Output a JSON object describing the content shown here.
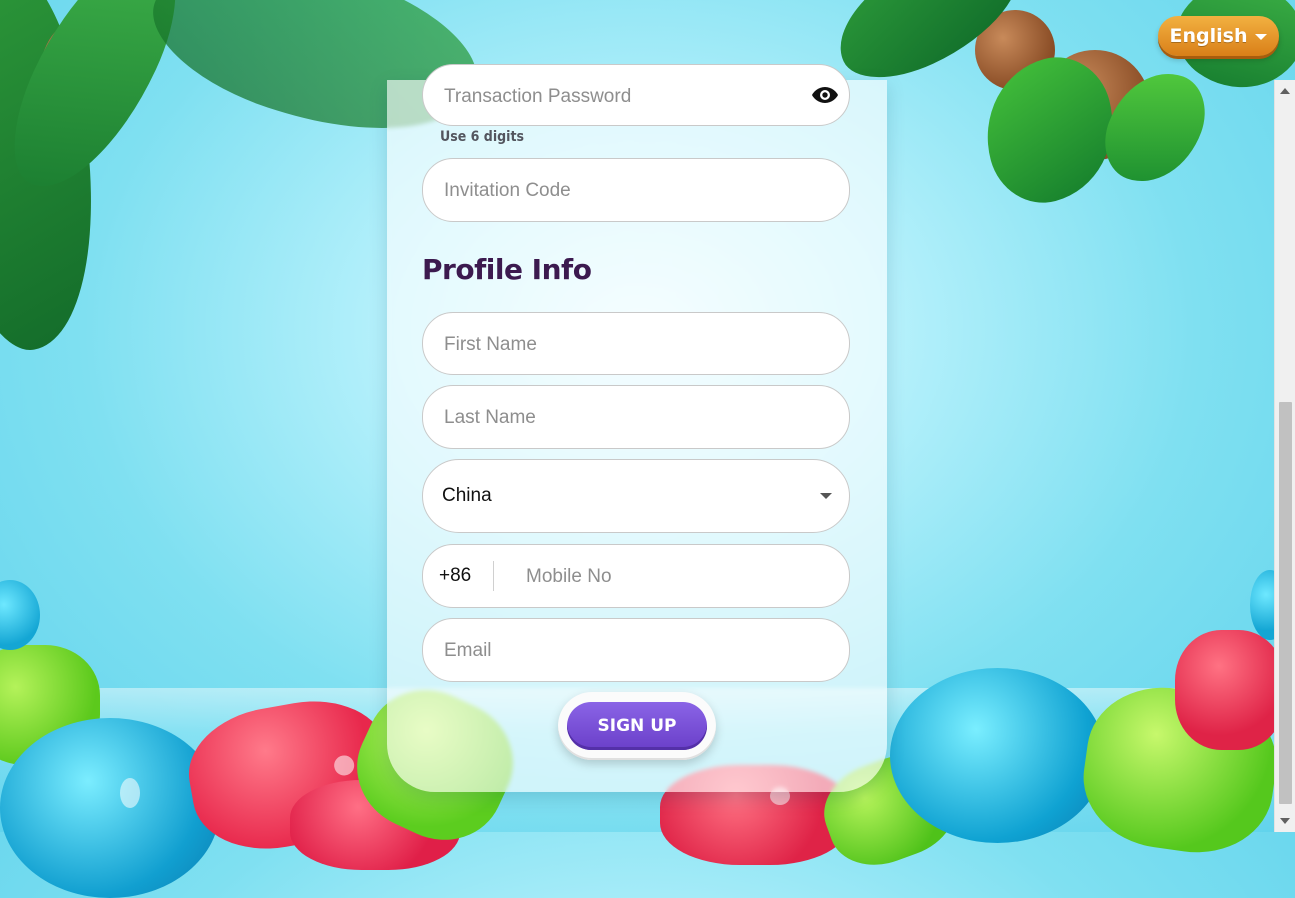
{
  "language": {
    "label": "English"
  },
  "form": {
    "transaction_password": {
      "placeholder": "Transaction Password",
      "hint": "Use 6 digits"
    },
    "invitation_code": {
      "placeholder": "Invitation Code"
    },
    "profile_section_title": "Profile Info",
    "first_name": {
      "placeholder": "First Name"
    },
    "last_name": {
      "placeholder": "Last Name"
    },
    "country": {
      "selected": "China"
    },
    "mobile": {
      "prefix": "+86",
      "placeholder": "Mobile No"
    },
    "email": {
      "placeholder": "Email"
    },
    "signup_label": "SIGN UP"
  },
  "icons": {
    "password_toggle": "eye-icon",
    "country_dropdown": "chevron-down-icon",
    "language_dropdown": "caret-down-icon"
  },
  "colors": {
    "accent_purple": "#6a3fc9",
    "title_purple": "#3c1a4f",
    "language_orange": "#e69a2a",
    "sky": "#7fe0f1"
  }
}
